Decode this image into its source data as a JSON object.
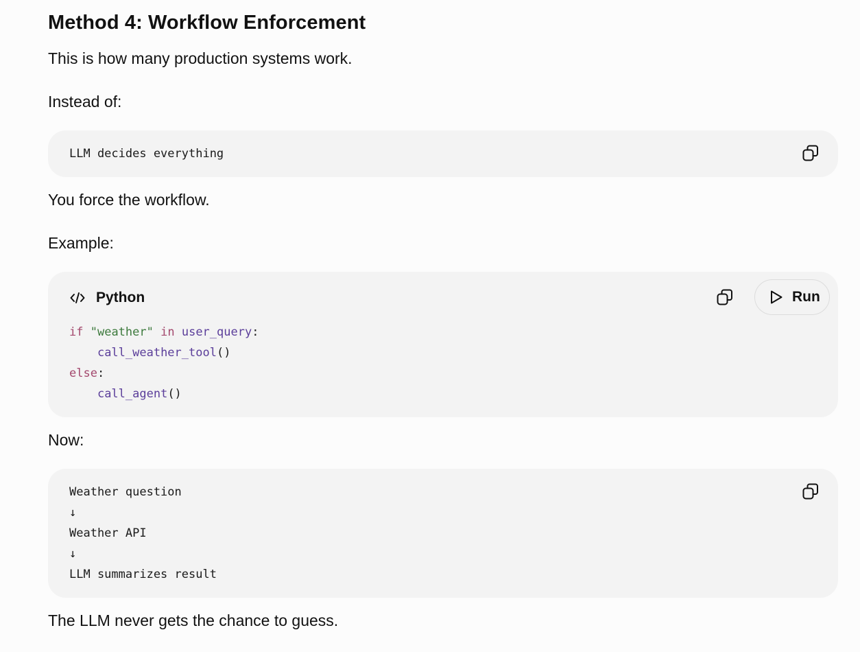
{
  "heading": "Method 4: Workflow Enforcement",
  "paragraphs": {
    "intro": "This is how many production systems work.",
    "instead": "Instead of:",
    "force": "You force the workflow.",
    "example": "Example:",
    "now": "Now:",
    "closing": "The LLM never gets the chance to guess."
  },
  "code_block_1": {
    "lines": [
      "LLM decides everything"
    ],
    "copy_icon": "copy-icon"
  },
  "code_block_2": {
    "language": "Python",
    "language_icon": "code-icon",
    "copy_icon": "copy-icon",
    "run_label": "Run",
    "run_icon": "play-icon",
    "tokens": {
      "line1": {
        "kw_if": "if",
        "str_weather": "\"weather\"",
        "kw_in": "in",
        "var": "user_query",
        "colon": ":"
      },
      "line2": {
        "indent": "    ",
        "fn": "call_weather_tool",
        "parens": "()"
      },
      "line3": {
        "kw_else": "else",
        "colon": ":"
      },
      "line4": {
        "indent": "    ",
        "fn": "call_agent",
        "parens": "()"
      }
    },
    "colors": {
      "keyword": "#a3486d",
      "string": "#3d7a3d",
      "identifier": "#5b3e9a"
    }
  },
  "code_block_3": {
    "lines": [
      "Weather question",
      "↓",
      "Weather API",
      "↓",
      "LLM summarizes result"
    ],
    "copy_icon": "copy-icon"
  }
}
